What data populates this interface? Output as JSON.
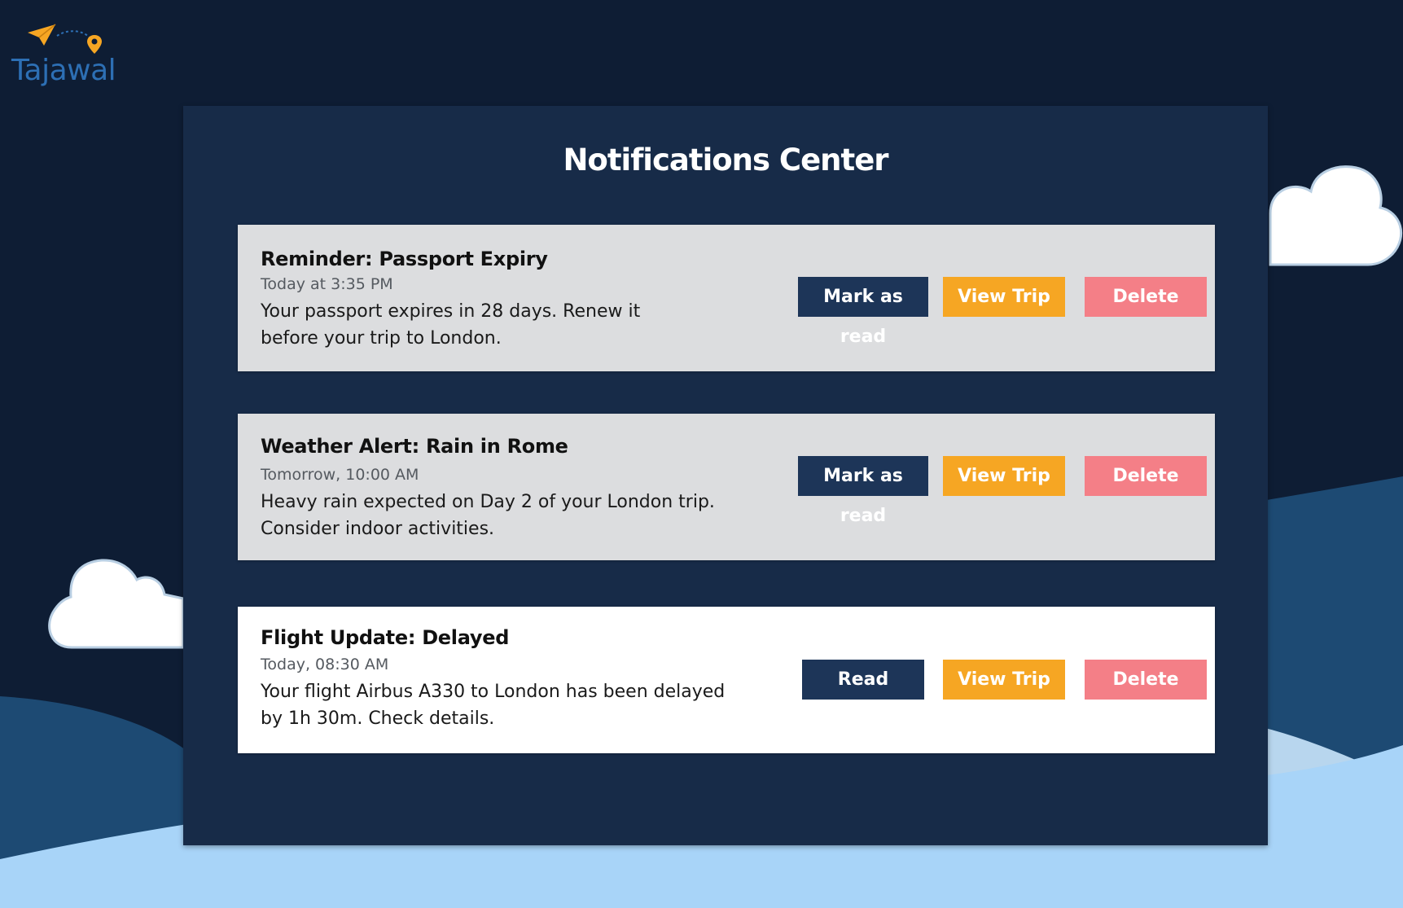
{
  "brand": {
    "name": "Tajawal",
    "colors": {
      "logo_text": "#2d6fb4",
      "logo_plane": "#f6a623"
    },
    "icons": [
      "paper-plane-icon",
      "location-pin-icon"
    ]
  },
  "page": {
    "title": "Notifications Center"
  },
  "colors": {
    "background_dark": "#0e1d34",
    "panel": "#172b48",
    "card_unread": "#dcdddf",
    "card_read": "#ffffff",
    "button_read": "#1d3558",
    "button_view_trip": "#f6a623",
    "button_delete": "#f47f87",
    "hill_mid": "#1d4a73",
    "hill_light": "#a8d4f8"
  },
  "notifications": [
    {
      "title": "Reminder: Passport Expiry",
      "time": "Today at 3:35 PM",
      "message": "Your passport expires in 28 days. Renew it\nbefore your trip to London.",
      "read": false,
      "read_button_label": "Mark as read",
      "view_trip_label": "View Trip",
      "delete_label": "Delete"
    },
    {
      "title": "Weather Alert: Rain in Rome",
      "time": "Tomorrow, 10:00 AM",
      "message": "Heavy rain expected on Day 2 of your London trip.\nConsider indoor activities.",
      "read": false,
      "read_button_label": "Mark as read",
      "view_trip_label": "View Trip",
      "delete_label": "Delete"
    },
    {
      "title": "Flight Update: Delayed",
      "time": "Today, 08:30 AM",
      "message": "Your flight Airbus A330 to London has been delayed\n by 1h 30m. Check details.",
      "read": true,
      "read_button_label": "Read",
      "view_trip_label": "View Trip",
      "delete_label": "Delete"
    }
  ]
}
